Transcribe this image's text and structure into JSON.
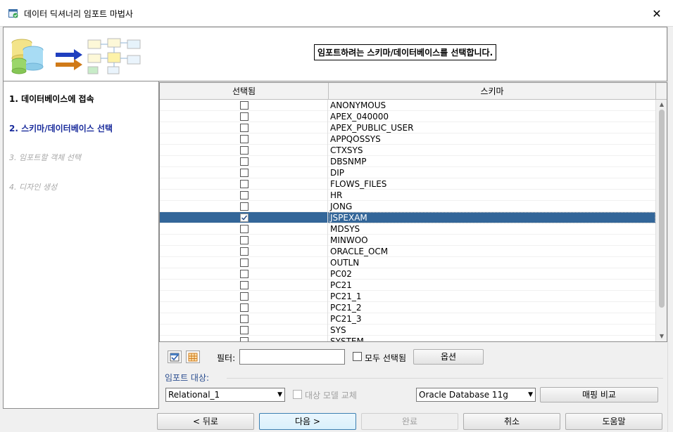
{
  "window": {
    "title": "데이터 딕셔너리 임포트 마법사",
    "close_glyph": "✕"
  },
  "header": {
    "instruction": "임포트하려는 스키마/데이터베이스를 선택합니다."
  },
  "steps": [
    {
      "label": "1. 데이터베이스에 접속",
      "state": "done"
    },
    {
      "label": "2. 스키마/데이터베이스 선택",
      "state": "current"
    },
    {
      "label": "3. 임포트할 객체 선택",
      "state": "future"
    },
    {
      "label": "4. 디자인 생성",
      "state": "future"
    }
  ],
  "table": {
    "columns": [
      "선택됨",
      "스키마"
    ],
    "rows": [
      {
        "selected": false,
        "name": "ANONYMOUS"
      },
      {
        "selected": false,
        "name": "APEX_040000"
      },
      {
        "selected": false,
        "name": "APEX_PUBLIC_USER"
      },
      {
        "selected": false,
        "name": "APPQOSSYS"
      },
      {
        "selected": false,
        "name": "CTXSYS"
      },
      {
        "selected": false,
        "name": "DBSNMP"
      },
      {
        "selected": false,
        "name": "DIP"
      },
      {
        "selected": false,
        "name": "FLOWS_FILES"
      },
      {
        "selected": false,
        "name": "HR"
      },
      {
        "selected": false,
        "name": "JONG"
      },
      {
        "selected": true,
        "name": "JSPEXAM"
      },
      {
        "selected": false,
        "name": "MDSYS"
      },
      {
        "selected": false,
        "name": "MINWOO"
      },
      {
        "selected": false,
        "name": "ORACLE_OCM"
      },
      {
        "selected": false,
        "name": "OUTLN"
      },
      {
        "selected": false,
        "name": "PC02"
      },
      {
        "selected": false,
        "name": "PC21"
      },
      {
        "selected": false,
        "name": "PC21_1"
      },
      {
        "selected": false,
        "name": "PC21_2"
      },
      {
        "selected": false,
        "name": "PC21_3"
      },
      {
        "selected": false,
        "name": "SYS"
      },
      {
        "selected": false,
        "name": "SYSTEM"
      }
    ],
    "selection_color": "#336699"
  },
  "filter_bar": {
    "filter_label": "필터:",
    "filter_value": "",
    "select_all_label": "모두 선택됨",
    "options_button": "옵션"
  },
  "import_target": {
    "caption": "임포트 대상:",
    "model_select": "Relational_1",
    "replace_label": "대상 모델 교체",
    "db_select": "Oracle Database 11g",
    "compare_button": "매핑 비교"
  },
  "buttons": {
    "back": "< 뒤로",
    "next": "다음 >",
    "finish": "완료",
    "cancel": "취소",
    "help": "도움말"
  },
  "icons": {
    "app": "wizard-app-icon",
    "check_all": "check-all-icon",
    "uncheck_all": "grid-icon"
  }
}
